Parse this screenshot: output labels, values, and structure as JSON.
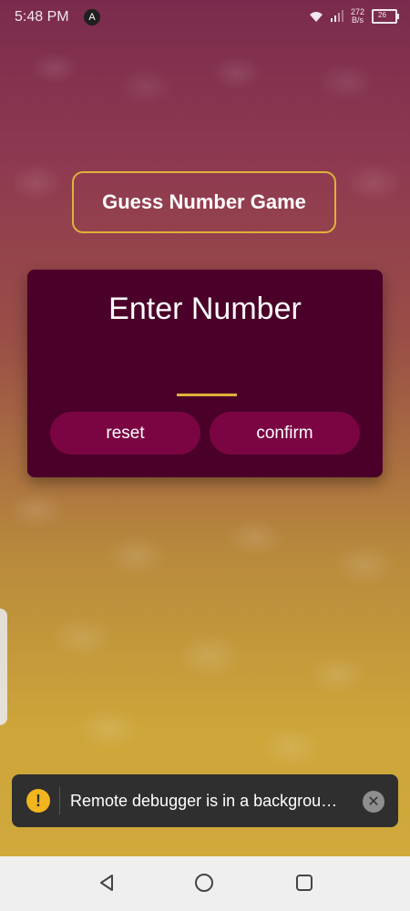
{
  "status": {
    "time": "5:48 PM",
    "app_icon": "A",
    "net_speed_value": "272",
    "net_speed_unit": "B/s",
    "battery_level": "26"
  },
  "header": {
    "title": "Guess Number Game"
  },
  "card": {
    "title": "Enter Number",
    "input_value": "",
    "reset_label": "reset",
    "confirm_label": "confirm"
  },
  "toast": {
    "message": "Remote debugger is in a background tab for best performance, keep it visible",
    "warn_symbol": "!",
    "close_symbol": "✕"
  },
  "colors": {
    "card_bg": "#4a0028",
    "button_bg": "#7a0542",
    "accent": "#e0b23a"
  },
  "icons": [
    "wifi-icon",
    "signal-icon",
    "battery-icon",
    "warning-icon",
    "close-icon",
    "back-icon",
    "home-icon",
    "recent-apps-icon"
  ]
}
